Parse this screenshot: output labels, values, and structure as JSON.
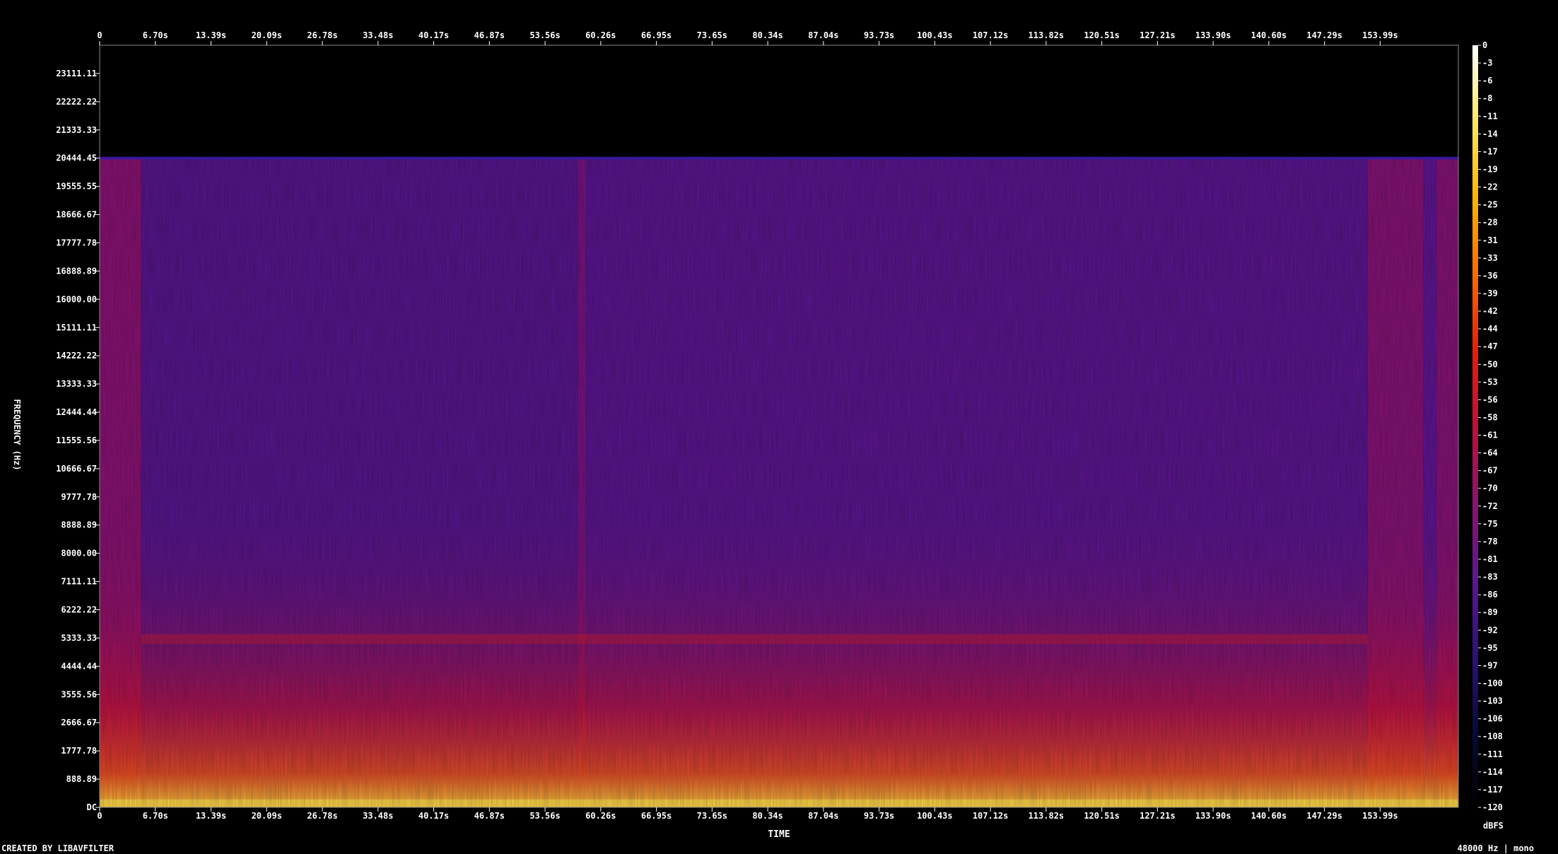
{
  "chart_data": {
    "type": "heatmap",
    "title": "",
    "xlabel": "TIME",
    "ylabel": "FREQUENCY (Hz)",
    "x_unit": "s",
    "xlim": [
      0,
      163.4
    ],
    "ylim": [
      0,
      24000
    ],
    "x_ticks": [
      "0",
      "6.70s",
      "13.39s",
      "20.09s",
      "26.78s",
      "33.48s",
      "40.17s",
      "46.87s",
      "53.56s",
      "60.26s",
      "66.95s",
      "73.65s",
      "80.34s",
      "87.04s",
      "93.73s",
      "100.43s",
      "107.12s",
      "113.82s",
      "120.51s",
      "127.21s",
      "133.90s",
      "140.60s",
      "147.29s",
      "153.99s"
    ],
    "y_ticks": [
      "DC",
      "888.89",
      "1777.78",
      "2666.67",
      "3555.56",
      "4444.44",
      "5333.33",
      "6222.22",
      "7111.11",
      "8000.00",
      "8888.89",
      "9777.78",
      "10666.67",
      "11555.56",
      "12444.44",
      "13333.33",
      "14222.22",
      "15111.11",
      "16000.00",
      "16888.89",
      "17777.78",
      "18666.67",
      "19555.55",
      "20444.45",
      "21333.33",
      "22222.22",
      "23111.11"
    ],
    "y_tick_values": [
      0,
      888.89,
      1777.78,
      2666.67,
      3555.56,
      4444.44,
      5333.33,
      6222.22,
      7111.11,
      8000.0,
      8888.89,
      9777.78,
      10666.67,
      11555.56,
      12444.44,
      13333.33,
      14222.22,
      15111.11,
      16000.0,
      16888.89,
      17777.78,
      18666.67,
      19555.55,
      20444.45,
      21333.33,
      22222.22,
      23111.11
    ],
    "cutoff_hz": 20444.45,
    "colorbar": {
      "label": "dBFS",
      "range": [
        -120,
        0
      ],
      "ticks": [
        "0",
        "-3",
        "-6",
        "-8",
        "-11",
        "-14",
        "-17",
        "-19",
        "-22",
        "-25",
        "-28",
        "-31",
        "-33",
        "-36",
        "-39",
        "-42",
        "-44",
        "-47",
        "-50",
        "-53",
        "-56",
        "-58",
        "-61",
        "-64",
        "-67",
        "-70",
        "-72",
        "-75",
        "-78",
        "-81",
        "-83",
        "-86",
        "-89",
        "-92",
        "-95",
        "-97",
        "-100",
        "-103",
        "-106",
        "-108",
        "-111",
        "-114",
        "-117",
        "-120"
      ],
      "stops": [
        {
          "db": -120,
          "color": "#000000"
        },
        {
          "db": -108,
          "color": "#0a0a3a"
        },
        {
          "db": -96,
          "color": "#2b1378"
        },
        {
          "db": -84,
          "color": "#5e1690"
        },
        {
          "db": -72,
          "color": "#8c1270"
        },
        {
          "db": -60,
          "color": "#c0103a"
        },
        {
          "db": -48,
          "color": "#e81c0a"
        },
        {
          "db": -36,
          "color": "#ff6a00"
        },
        {
          "db": -24,
          "color": "#ffb400"
        },
        {
          "db": -12,
          "color": "#ffe860"
        },
        {
          "db": 0,
          "color": "#ffffff"
        }
      ]
    },
    "segments": [
      {
        "t": [
          0,
          5
        ],
        "level_db": -73
      },
      {
        "t": [
          5,
          57.5
        ],
        "level_db": -86
      },
      {
        "t": [
          57.5,
          58.5
        ],
        "level_db": -78
      },
      {
        "t": [
          58.5,
          152.5
        ],
        "level_db": -85
      },
      {
        "t": [
          152.5,
          159.2
        ],
        "level_db": -74
      },
      {
        "t": [
          159.2,
          160.8
        ],
        "level_db": -84
      },
      {
        "t": [
          160.8,
          163.4
        ],
        "level_db": -74
      }
    ]
  },
  "footer": {
    "left": "CREATED BY LIBAVFILTER",
    "right": "48000 Hz | mono"
  }
}
